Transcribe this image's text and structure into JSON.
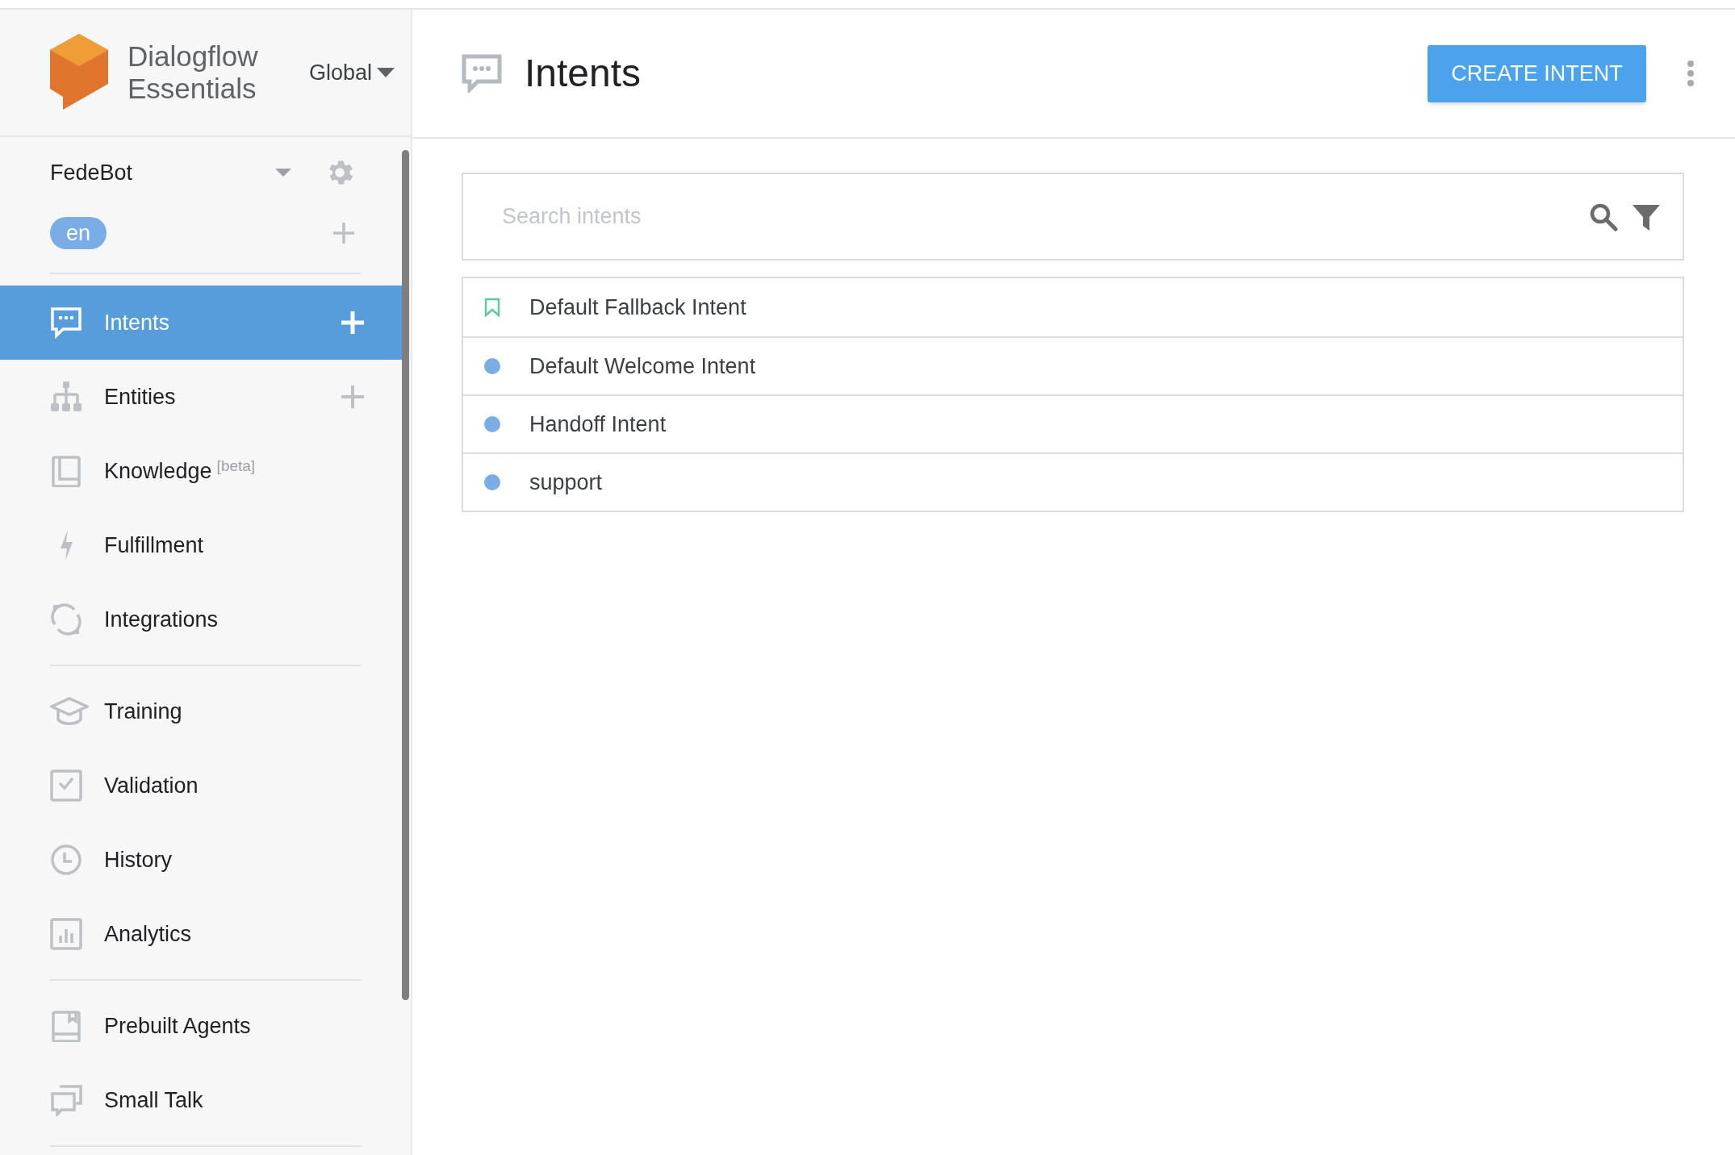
{
  "brand": {
    "name_line_1": "Dialogflow",
    "name_line_2": "Essentials",
    "region": "Global"
  },
  "agent": {
    "name": "FedeBot",
    "language": "en"
  },
  "sidebar": {
    "sections": [
      {
        "items": [
          {
            "label": "Intents",
            "selected": true,
            "add_button": true
          },
          {
            "label": "Entities",
            "selected": false,
            "add_button": true
          },
          {
            "label": "Knowledge",
            "badge": "[beta]",
            "selected": false,
            "add_button": false
          },
          {
            "label": "Fulfillment",
            "selected": false,
            "add_button": false
          },
          {
            "label": "Integrations",
            "selected": false,
            "add_button": false
          }
        ]
      },
      {
        "items": [
          {
            "label": "Training",
            "selected": false,
            "add_button": false
          },
          {
            "label": "Validation",
            "selected": false,
            "add_button": false
          },
          {
            "label": "History",
            "selected": false,
            "add_button": false
          },
          {
            "label": "Analytics",
            "selected": false,
            "add_button": false
          }
        ]
      },
      {
        "items": [
          {
            "label": "Prebuilt Agents",
            "selected": false,
            "add_button": false
          },
          {
            "label": "Small Talk",
            "selected": false,
            "add_button": false
          }
        ]
      }
    ]
  },
  "header": {
    "title": "Intents",
    "primary_button": "CREATE INTENT"
  },
  "search": {
    "placeholder": "Search intents"
  },
  "intents": [
    {
      "name": "Default Fallback Intent",
      "kind": "fallback",
      "color": "#5fc9a0"
    },
    {
      "name": "Default Welcome Intent",
      "kind": "normal",
      "color": "#7aade6"
    },
    {
      "name": "Handoff Intent",
      "kind": "normal",
      "color": "#7aade6"
    },
    {
      "name": "support",
      "kind": "normal",
      "color": "#7aade6"
    }
  ]
}
